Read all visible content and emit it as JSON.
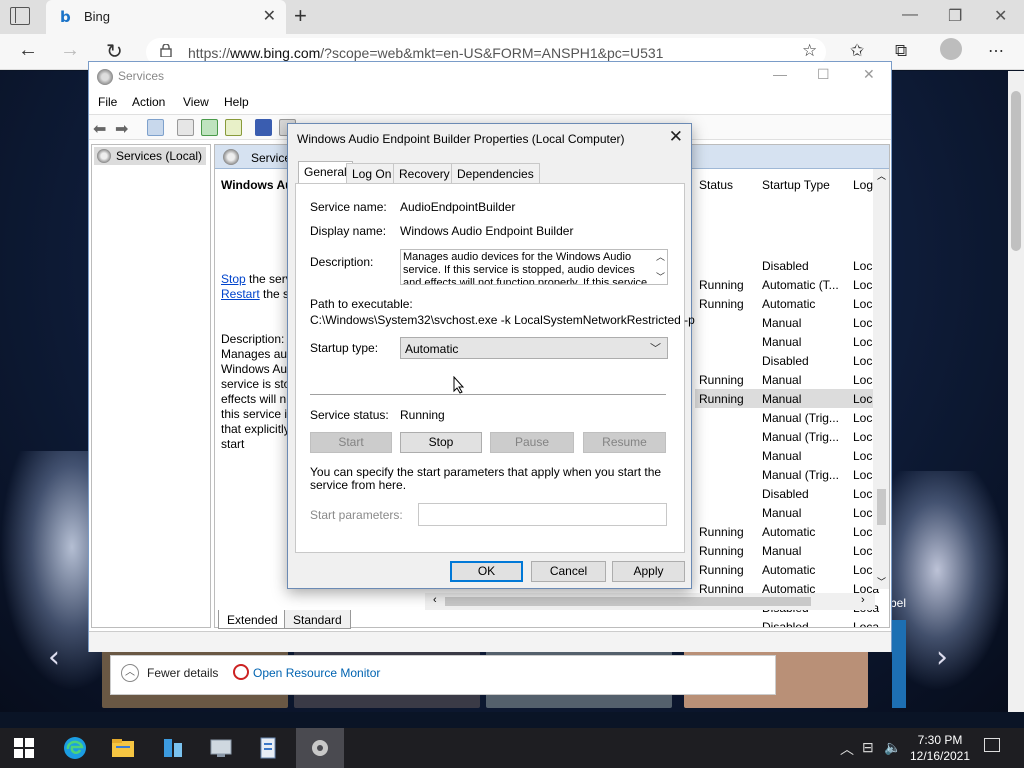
{
  "browser": {
    "tab_title": "Bing",
    "tab_logo": "b",
    "url_prefix": "https://",
    "url_host": "www.bing.com",
    "url_rest": "/?scope=web&mkt=en-US&FORM=ANSPH1&pc=U531"
  },
  "page": {
    "partial_label": "bel",
    "task_manager": {
      "fewer_details": "Fewer details",
      "open_resource_monitor": "Open Resource Monitor"
    }
  },
  "services_window": {
    "title": "Services",
    "menu": [
      "File",
      "Action",
      "View",
      "Help"
    ],
    "tree_item": "Services (Local)",
    "content_header": "Services",
    "detail": {
      "title": "Windows Au",
      "stop_link": "Stop",
      "stop_rest": " the serv",
      "restart_link": "Restart",
      "restart_rest": " the se",
      "description_label": "Description:",
      "description_lines": [
        "Manages aud",
        "Windows Au",
        "service is sto",
        "effects will n",
        "this service is",
        "that explicitly",
        "start"
      ]
    },
    "columns": {
      "status": "Status",
      "startup_type": "Startup Type",
      "log_on": "Log"
    },
    "rows": [
      {
        "status": "",
        "startup": "Disabled",
        "log": "Loca"
      },
      {
        "status": "Running",
        "startup": "Automatic (T...",
        "log": "Loca"
      },
      {
        "status": "Running",
        "startup": "Automatic",
        "log": "Loca"
      },
      {
        "status": "",
        "startup": "Manual",
        "log": "Loca"
      },
      {
        "status": "",
        "startup": "Manual",
        "log": "Loca"
      },
      {
        "status": "",
        "startup": "Disabled",
        "log": "Loca"
      },
      {
        "status": "Running",
        "startup": "Manual",
        "log": "Loca"
      },
      {
        "status": "Running",
        "startup": "Manual",
        "log": "Loca"
      },
      {
        "status": "",
        "startup": "Manual (Trig...",
        "log": "Loca"
      },
      {
        "status": "",
        "startup": "Manual (Trig...",
        "log": "Loca"
      },
      {
        "status": "",
        "startup": "Manual",
        "log": "Loca"
      },
      {
        "status": "",
        "startup": "Manual (Trig...",
        "log": "Loca"
      },
      {
        "status": "",
        "startup": "Disabled",
        "log": "Loca"
      },
      {
        "status": "",
        "startup": "Manual",
        "log": "Loca"
      },
      {
        "status": "Running",
        "startup": "Automatic",
        "log": "Loca"
      },
      {
        "status": "Running",
        "startup": "Manual",
        "log": "Loca"
      },
      {
        "status": "Running",
        "startup": "Automatic",
        "log": "Loca"
      },
      {
        "status": "Running",
        "startup": "Automatic",
        "log": "Loca"
      },
      {
        "status": "",
        "startup": "Disabled",
        "log": "Loca"
      },
      {
        "status": "",
        "startup": "Disabled",
        "log": "Loca"
      },
      {
        "status": "",
        "startup": "Manual",
        "log": "Loca"
      }
    ],
    "selected_row": 7,
    "bottom_tabs": [
      "Extended",
      "Standard"
    ]
  },
  "dialog": {
    "title": "Windows Audio Endpoint Builder Properties (Local Computer)",
    "tabs": [
      "General",
      "Log On",
      "Recovery",
      "Dependencies"
    ],
    "active_tab": "General",
    "service_name_label": "Service name:",
    "service_name": "AudioEndpointBuilder",
    "display_name_label": "Display name:",
    "display_name": "Windows Audio Endpoint Builder",
    "description_label": "Description:",
    "description": "Manages audio devices for the Windows Audio service.  If this service is stopped, audio devices and effects will not function properly.  If this service",
    "path_label": "Path to executable:",
    "path": "C:\\Windows\\System32\\svchost.exe -k LocalSystemNetworkRestricted -p",
    "startup_type_label": "Startup type:",
    "startup_type": "Automatic",
    "service_status_label": "Service status:",
    "service_status": "Running",
    "buttons": {
      "start": "Start",
      "stop": "Stop",
      "pause": "Pause",
      "resume": "Resume"
    },
    "hint": "You can specify the start parameters that apply when you start the service from here.",
    "start_params_label": "Start parameters:",
    "start_params_value": "",
    "ok": "OK",
    "cancel": "Cancel",
    "apply": "Apply"
  },
  "taskbar": {
    "time": "7:30 PM",
    "date": "12/16/2021"
  },
  "colors": {
    "accent": "#0078d7",
    "link": "#0044cc",
    "header_bg": "#d6e2f1"
  }
}
